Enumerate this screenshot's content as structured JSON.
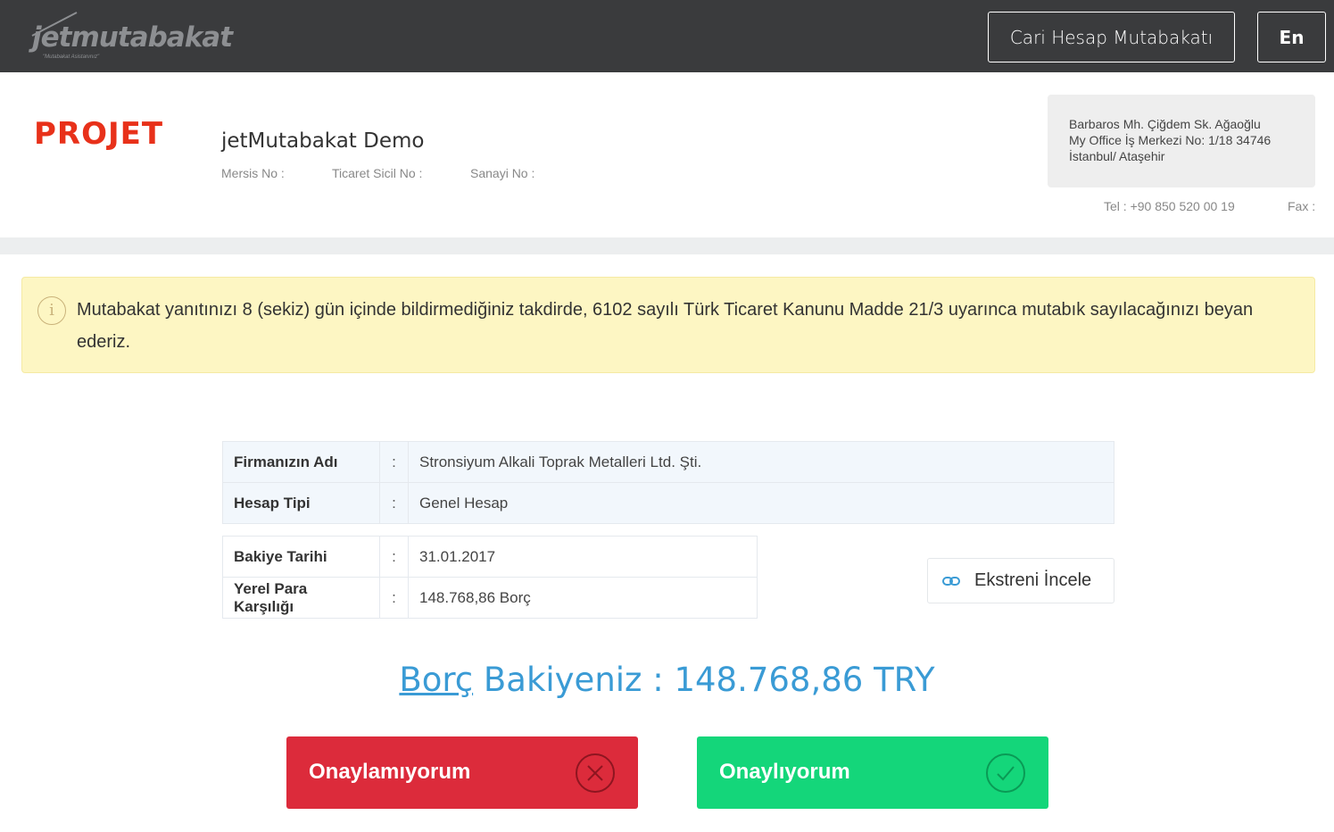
{
  "header": {
    "logo_text": "jetmutabakat",
    "logo_slogan": "\"Mutabakat Asistanınız\"",
    "cari_button": "Cari Hesap Mutabakatı",
    "lang_button": "En"
  },
  "company": {
    "brand_logo": "PROJET",
    "name": "jetMutabakat Demo",
    "mersis_label": "Mersis No :",
    "ticaret_label": "Ticaret Sicil No :",
    "sanayi_label": "Sanayi No :",
    "address_line1": "Barbaros Mh. Çiğdem Sk. Ağaoğlu",
    "address_line2": "My Office İş Merkezi No: 1/18 34746",
    "address_line3": "İstanbul/ Ataşehir",
    "tel": "Tel : +90 850 520 00 19",
    "fax": "Fax :"
  },
  "warning": {
    "text": "Mutabakat yanıtınızı 8 (sekiz) gün içinde bildirmediğiniz takdirde, 6102 sayılı Türk Ticaret Kanunu Madde 21/3 uyarınca mutabık sayılacağınızı beyan ederiz."
  },
  "account": {
    "firm_label": "Firmanızın Adı",
    "firm_value": "Stronsiyum Alkali Toprak Metalleri Ltd. Şti.",
    "type_label": "Hesap Tipi",
    "type_value": "Genel Hesap",
    "date_label": "Bakiye Tarihi",
    "date_value": "31.01.2017",
    "local_label": "Yerel Para Karşılığı",
    "local_value": "148.768,86 Borç",
    "separator": ":"
  },
  "ekstre_button": "Ekstreni İncele",
  "balance": {
    "kind": "Borç",
    "text": " Bakiyeniz : 148.768,86 TRY"
  },
  "actions": {
    "reject": "Onaylamıyorum",
    "approve": "Onaylıyorum"
  },
  "colors": {
    "topbar": "#3a3b3d",
    "brand": "#e8311a",
    "warning_bg": "#fdf6c3",
    "balance": "#3a9bd5",
    "reject": "#dc2b3b",
    "approve": "#14d67a"
  }
}
